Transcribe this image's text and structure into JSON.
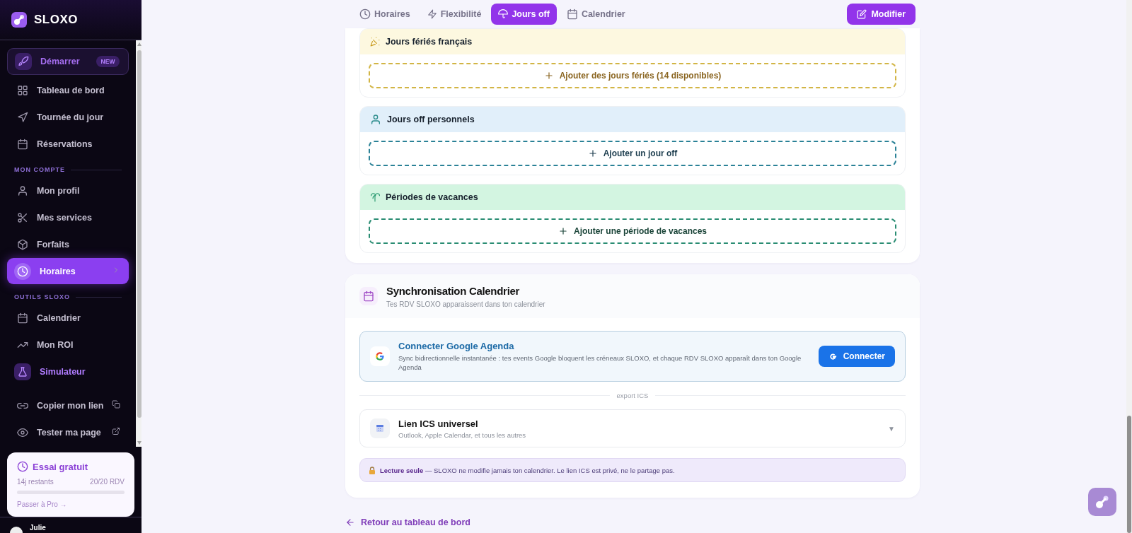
{
  "sidebar": {
    "brand": "SLOXO",
    "groups": [
      {
        "items": [
          {
            "label": "Démarrer",
            "kind": "featured",
            "badge": "NEW",
            "selected": false
          },
          {
            "label": "Tableau de bord",
            "kind": "item",
            "selected": false
          },
          {
            "label": "Tournée du jour",
            "kind": "item",
            "selected": false
          },
          {
            "label": "Réservations",
            "kind": "item",
            "selected": false
          }
        ]
      },
      {
        "label": "MON COMPTE",
        "items": [
          {
            "label": "Mon profil",
            "kind": "item",
            "selected": false
          },
          {
            "label": "Mes services",
            "kind": "item",
            "selected": false
          },
          {
            "label": "Forfaits",
            "kind": "item",
            "selected": false
          },
          {
            "label": "Horaires",
            "kind": "item",
            "selected": true
          }
        ]
      },
      {
        "label": "OUTILS SLOXO",
        "items": [
          {
            "label": "Calendrier",
            "kind": "item",
            "selected": false
          },
          {
            "label": "Mon ROI",
            "kind": "item",
            "selected": false
          },
          {
            "label": "Simulateur",
            "kind": "accent",
            "selected": false
          }
        ]
      },
      {
        "items": [
          {
            "label": "Copier mon lien",
            "kind": "item",
            "selected": false
          },
          {
            "label": "Tester ma page",
            "kind": "item",
            "selected": false
          }
        ]
      }
    ],
    "trial": {
      "title": "Essai gratuit",
      "remaining": "14j restants",
      "usage": "20/20 RDV",
      "level": 0,
      "link": "Passer à Pro →"
    },
    "user": {
      "name": "Julie"
    }
  },
  "tabs": [
    {
      "label": "Horaires",
      "selected": false
    },
    {
      "label": "Flexibilité",
      "selected": false
    },
    {
      "label": "Jours off",
      "selected": true
    },
    {
      "label": "Calendrier",
      "selected": false
    }
  ],
  "edit_button": "Modifier",
  "days_off": [
    {
      "kind": "holiday",
      "title": "Jours fériés français",
      "action": "Ajouter des jours fériés (14 disponibles)"
    },
    {
      "kind": "personal",
      "title": "Jours off personnels",
      "action": "Ajouter un jour off"
    },
    {
      "kind": "vacation",
      "title": "Périodes de vacances",
      "action": "Ajouter une période de vacances"
    }
  ],
  "sync": {
    "title": "Synchronisation Calendrier",
    "subtitle": "Tes RDV SLOXO apparaissent dans ton calendrier",
    "google": {
      "title": "Connecter Google Agenda",
      "description": "Sync bidirectionnelle instantanée : tes events Google bloquent les créneaux SLOXO, et chaque RDV SLOXO apparaît dans ton Google Agenda",
      "button": "Connecter"
    },
    "divider": "export ICS",
    "ics": {
      "title": "Lien ICS universel",
      "subtitle": "Outlook, Apple Calendar, et tous les autres",
      "toggle": "▼"
    },
    "notice": "**Lecture seule** — SLOXO ne modifie jamais ton calendrier. Le lien ICS est privé, ne le partage pas."
  },
  "back_link": "Retour au tableau de bord"
}
